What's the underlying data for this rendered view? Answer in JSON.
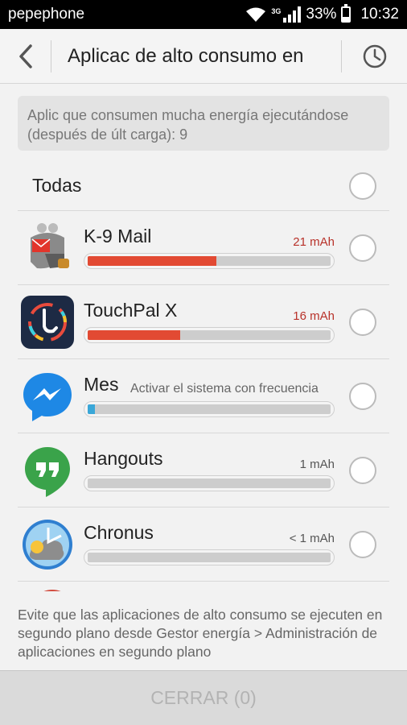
{
  "status_bar": {
    "carrier": "pepephone",
    "network": "3G",
    "battery": "33%",
    "battery_level": 0.33,
    "time": "10:32"
  },
  "header": {
    "title": "Aplicac de alto consumo en"
  },
  "info": {
    "text": "Aplic que consumen mucha energía ejecutándose (después de últ carga): 9"
  },
  "select_all": {
    "label": "Todas"
  },
  "apps": [
    {
      "name": "K-9 Mail",
      "usage": "21 mAh",
      "usage_level": 0.53,
      "bar_color": "#e24a33",
      "high": true
    },
    {
      "name": "TouchPal X",
      "usage": "16 mAh",
      "usage_level": 0.38,
      "bar_color": "#e24a33",
      "high": true
    },
    {
      "name": "Mes",
      "usage": "",
      "tooltip": "Activar el sistema con frecuencia",
      "usage_level": 0.03,
      "bar_color": "#3aa7d8",
      "high": false
    },
    {
      "name": "Hangouts",
      "usage": "1 mAh",
      "usage_level": 0.0,
      "bar_color": "#cdcdcd",
      "high": false
    },
    {
      "name": "Chronus",
      "usage": "< 1 mAh",
      "usage_level": 0.0,
      "bar_color": "#cdcdcd",
      "high": false
    }
  ],
  "footer": {
    "note": "Evite que las aplicaciones de alto consumo se ejecuten en segundo plano desde Gestor energía > Administración de aplicaciones en segundo plano",
    "close_label": "CERRAR (0)"
  },
  "colors": {
    "accent_red": "#e24a33",
    "usage_red_text": "#b8322a",
    "messenger_blue": "#1e88e5",
    "hangouts_green": "#3aa34a"
  }
}
